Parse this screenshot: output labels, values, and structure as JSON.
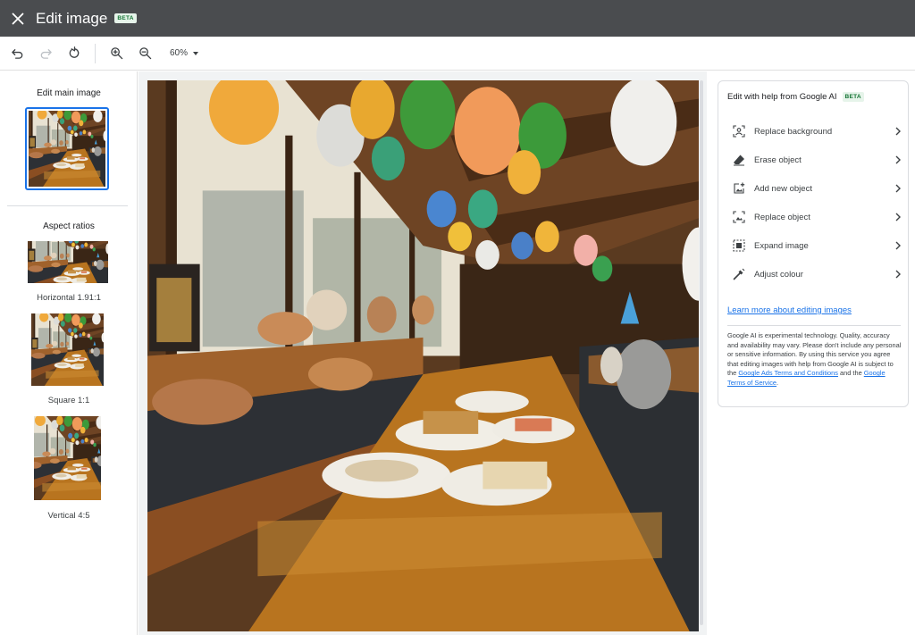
{
  "header": {
    "title": "Edit image",
    "badge": "BETA",
    "close_icon": "close-icon"
  },
  "toolbar": {
    "icons": [
      "undo-icon",
      "redo-icon",
      "reset-icon",
      "zoom-in-icon",
      "zoom-out-icon"
    ],
    "zoom_level": "60%"
  },
  "left_panel": {
    "main_heading": "Edit main image",
    "aspect_heading": "Aspect ratios",
    "ratios": [
      {
        "label": "Horizontal 1.91:1"
      },
      {
        "label": "Square 1:1"
      },
      {
        "label": "Vertical 4:5"
      }
    ]
  },
  "right_panel": {
    "title": "Edit with help from Google AI",
    "badge": "BETA",
    "items": [
      {
        "label": "Replace background",
        "icon": "replace-background-icon"
      },
      {
        "label": "Erase object",
        "icon": "eraser-icon"
      },
      {
        "label": "Add new object",
        "icon": "add-object-icon"
      },
      {
        "label": "Replace object",
        "icon": "replace-object-icon"
      },
      {
        "label": "Expand image",
        "icon": "expand-image-icon"
      },
      {
        "label": "Adjust colour",
        "icon": "adjust-colour-icon"
      }
    ],
    "learn_more": "Learn more about editing images",
    "disclaimer": {
      "text": "Google AI is experimental technology. Quality, accuracy and availability may vary. Please don't include any personal or sensitive information. By using this service you agree that editing images with help from Google AI is subject to the",
      "link1": "Google Ads Terms and Conditions",
      "middle": "and the",
      "link2": "Google Terms of Service",
      "end": "."
    }
  },
  "colors": {
    "header_bg": "#4a4c4f",
    "accent": "#1a73e8",
    "beta_bg": "#e6f4ea",
    "beta_text": "#137333"
  }
}
